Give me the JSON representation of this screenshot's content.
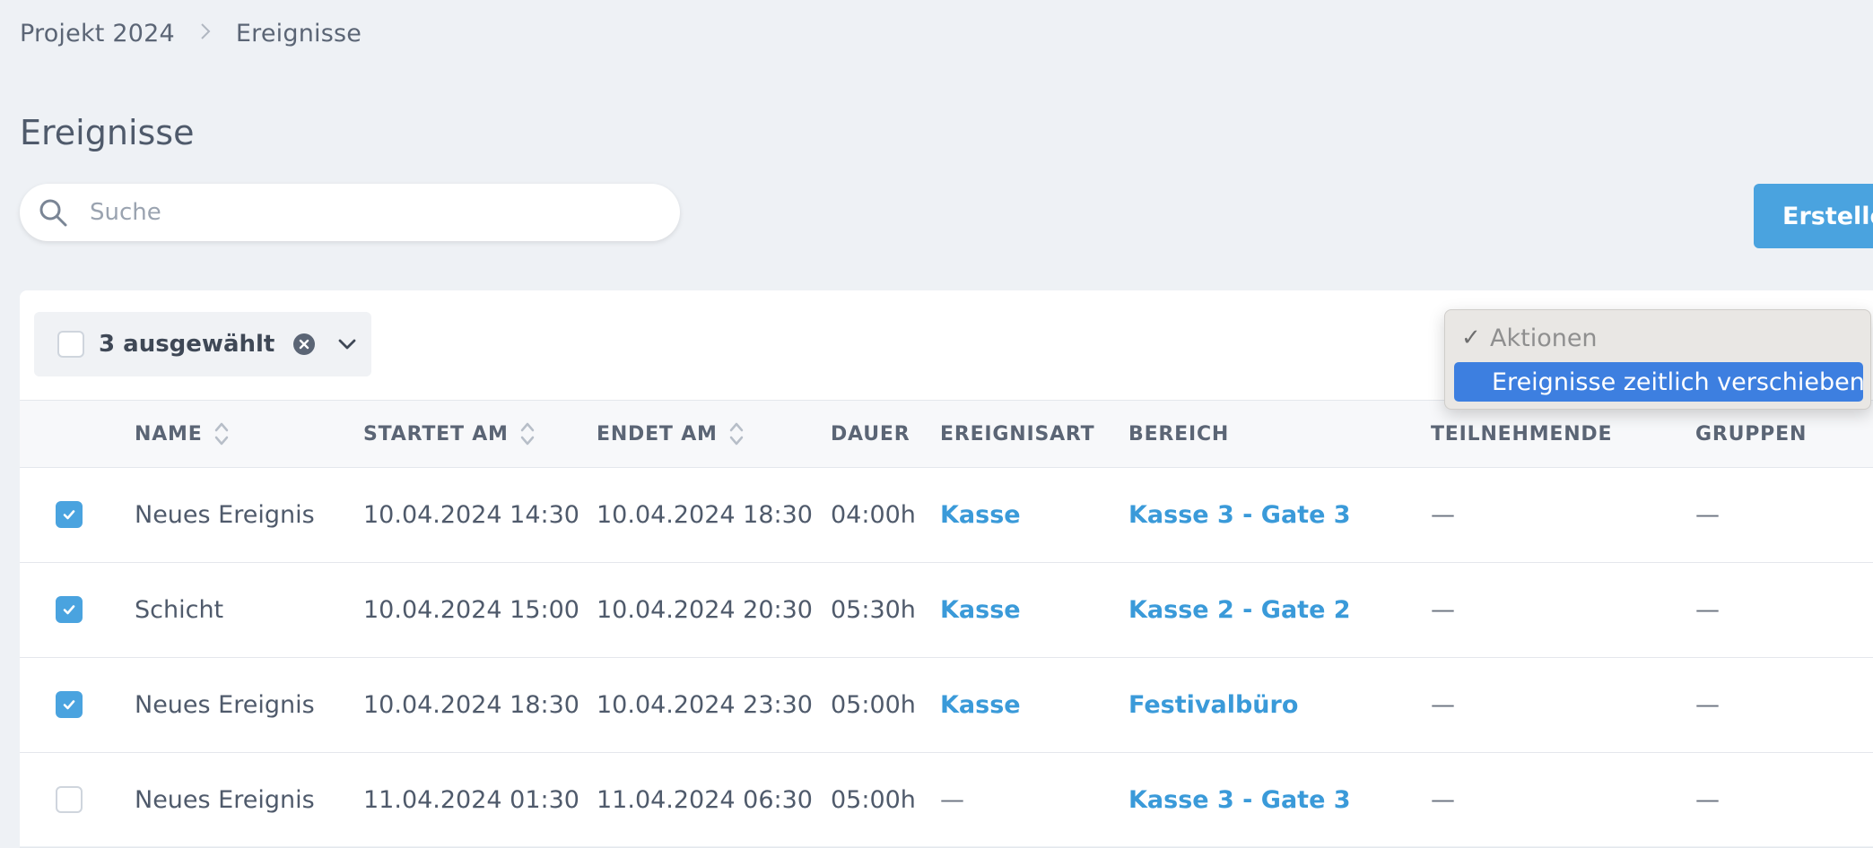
{
  "breadcrumb": {
    "project": "Projekt 2024",
    "current": "Ereignisse"
  },
  "page_title": "Ereignisse",
  "search": {
    "placeholder": "Suche",
    "value": ""
  },
  "create_button_label": "Erstellen",
  "bulk": {
    "selected_label": "3 ausgewählt"
  },
  "actions_dropdown": {
    "header": "Aktionen",
    "options": [
      "Ereignisse zeitlich verschieben"
    ],
    "highlighted": "Ereignisse zeitlich verschieben"
  },
  "table": {
    "headers": {
      "name": "NAME",
      "start": "STARTET AM",
      "end": "ENDET AM",
      "duration": "DAUER",
      "type": "EREIGNISART",
      "area": "BEREICH",
      "participants": "TEILNEHMENDE",
      "groups": "GRUPPEN"
    },
    "rows": [
      {
        "checked": true,
        "name": "Neues Ereignis",
        "start": "10.04.2024 14:30",
        "end": "10.04.2024 18:30",
        "duration": "04:00h",
        "type": "Kasse",
        "area": "Kasse 3 - Gate 3",
        "participants": "—",
        "groups": "—"
      },
      {
        "checked": true,
        "name": "Schicht",
        "start": "10.04.2024 15:00",
        "end": "10.04.2024 20:30",
        "duration": "05:30h",
        "type": "Kasse",
        "area": "Kasse 2 - Gate 2",
        "participants": "—",
        "groups": "—"
      },
      {
        "checked": true,
        "name": "Neues Ereignis",
        "start": "10.04.2024 18:30",
        "end": "10.04.2024 23:30",
        "duration": "05:00h",
        "type": "Kasse",
        "area": "Festivalbüro",
        "participants": "—",
        "groups": "—"
      },
      {
        "checked": false,
        "name": "Neues Ereignis",
        "start": "11.04.2024 01:30",
        "end": "11.04.2024 06:30",
        "duration": "05:00h",
        "type": "—",
        "area": "Kasse 3 - Gate 3",
        "participants": "—",
        "groups": "—"
      }
    ]
  },
  "colors": {
    "accent": "#4aa3df",
    "link": "#3a9ad9",
    "background": "#eef1f5",
    "dropdown_highlight": "#3d7fe0"
  },
  "icons": {
    "search": "search-icon",
    "clear": "clear-selection-icon",
    "dropdown": "chevron-down-icon",
    "sort": "sort-icon",
    "check": "checkmark-icon"
  }
}
